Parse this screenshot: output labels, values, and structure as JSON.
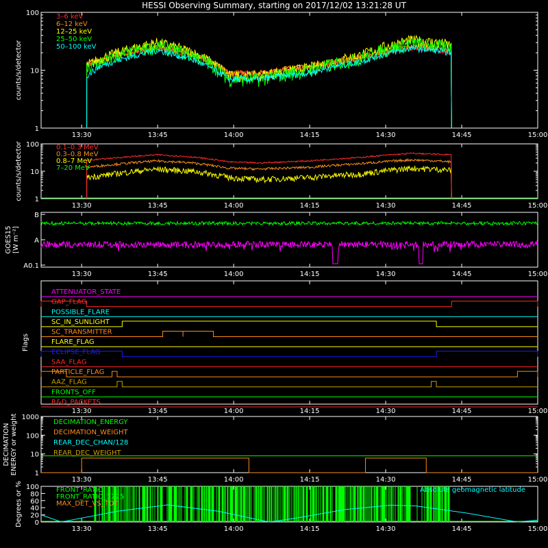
{
  "title": "HESSI Observing Summary, starting on 2017/12/02 13:21:28 UT",
  "time_ticks": [
    "13:30",
    "13:45",
    "14:00",
    "14:15",
    "14:30",
    "14:45",
    "15:00"
  ],
  "colors": {
    "background": "#000000",
    "axes": "#ffffff",
    "red": "#ff2a2a",
    "orange": "#ff8c1a",
    "yellow": "#ffff00",
    "green": "#00ff00",
    "cyan": "#00ffff",
    "magenta": "#ff00ff",
    "blue": "#1a1aff",
    "olive": "#c8a000",
    "mint": "#00ff88"
  },
  "chart_data": [
    {
      "id": "lo",
      "type": "line",
      "ylabel": "counts/s/detector",
      "yscale": "log",
      "ylim": [
        1,
        100
      ],
      "yticks": [
        "1",
        "10",
        "100"
      ],
      "x": [
        "13:31",
        "13:34",
        "13:45",
        "13:52",
        "13:59",
        "14:05",
        "14:15",
        "14:25",
        "14:35",
        "14:40",
        "14:43"
      ],
      "series": [
        {
          "name": "3–6 keV",
          "color": "#ff2a2a",
          "values": [
            13,
            15,
            24,
            18,
            9,
            9,
            11,
            16,
            24,
            22,
            20
          ]
        },
        {
          "name": "6–12 keV",
          "color": "#ff8c1a",
          "values": [
            12,
            15,
            25,
            19,
            9,
            9,
            12,
            17,
            26,
            24,
            22
          ]
        },
        {
          "name": "12–25 keV",
          "color": "#ffff00",
          "values": [
            12,
            16,
            30,
            20,
            8,
            8,
            11,
            18,
            33,
            30,
            27
          ]
        },
        {
          "name": "25–50 keV",
          "color": "#00ff00",
          "values": [
            10,
            14,
            26,
            18,
            7,
            7,
            10,
            16,
            29,
            27,
            24
          ]
        },
        {
          "name": "50–100 keV",
          "color": "#00ffff",
          "values": [
            8,
            12,
            22,
            15,
            7,
            7,
            9,
            14,
            24,
            22,
            20
          ]
        }
      ]
    },
    {
      "id": "hi",
      "type": "line",
      "ylabel": "counts/s/detector",
      "yscale": "log",
      "ylim": [
        1,
        100
      ],
      "yticks": [
        "1",
        "10",
        "100"
      ],
      "x": [
        "13:31",
        "13:34",
        "13:45",
        "13:52",
        "13:59",
        "14:05",
        "14:15",
        "14:25",
        "14:35",
        "14:40",
        "14:43"
      ],
      "series": [
        {
          "name": "0.1–0.3 MeV",
          "color": "#ff2a2a",
          "values": [
            25,
            28,
            40,
            33,
            22,
            20,
            24,
            32,
            45,
            42,
            40
          ]
        },
        {
          "name": "0.3–0.8 MeV",
          "color": "#ff8c1a",
          "values": [
            14,
            16,
            24,
            20,
            13,
            12,
            14,
            19,
            26,
            24,
            22
          ]
        },
        {
          "name": "0.8–7 MeV",
          "color": "#ffff00",
          "values": [
            6,
            7,
            12,
            10,
            6,
            5,
            6,
            8,
            13,
            12,
            11
          ]
        },
        {
          "name": "7–20 MeV",
          "color": "#00ff00",
          "values": []
        }
      ]
    },
    {
      "id": "goes",
      "type": "line",
      "ylabel": "GOES15",
      "ylabel2": "[W m⁻²]",
      "yticks": [
        "A0.1",
        "A",
        "B"
      ],
      "x": [
        "13:22",
        "13:45",
        "14:00",
        "14:18",
        "14:20",
        "14:30",
        "14:37",
        "14:45",
        "15:00"
      ],
      "series": [
        {
          "name": "GOES long",
          "color": "#00ff00",
          "values": [
            "B",
            "B",
            "B",
            "B",
            "B",
            "B",
            "B",
            "B",
            "B"
          ]
        },
        {
          "name": "GOES short",
          "color": "#ff00ff",
          "values": [
            "A",
            "A",
            "A",
            "A",
            "A0.1",
            "A",
            "A0.1",
            "A",
            "A"
          ]
        }
      ]
    },
    {
      "id": "flags",
      "type": "table",
      "ylabel": "Flags",
      "rows": [
        {
          "name": "ATTENUATOR_STATE",
          "color": "#ff00ff",
          "segments": []
        },
        {
          "name": "GAP_FLAG",
          "color": "#ff2a2a",
          "segments": [
            [
              "13:22",
              "13:31"
            ],
            [
              "14:43",
              "15:00"
            ]
          ]
        },
        {
          "name": "POSSIBLE_FLARE",
          "color": "#00ffff",
          "segments": []
        },
        {
          "name": "SC_IN_SUNLIGHT",
          "color": "#ffff00",
          "segments": [
            [
              "13:38",
              "14:40"
            ]
          ]
        },
        {
          "name": "SC_TRANSMITTER",
          "color": "#ff8c1a",
          "segments": [
            [
              "13:46",
              "13:50"
            ],
            [
              "13:50",
              "13:56"
            ]
          ]
        },
        {
          "name": "FLARE_FLAG",
          "color": "#ffff00",
          "segments": []
        },
        {
          "name": "ECLIPSE_FLAG",
          "color": "#1a1aff",
          "segments": [
            [
              "13:22",
              "13:38"
            ],
            [
              "14:40",
              "15:00"
            ]
          ]
        },
        {
          "name": "SAA_FLAG",
          "color": "#ff2a2a",
          "segments": []
        },
        {
          "name": "PARTICLE_FLAG",
          "color": "#ff8c1a",
          "segments": [
            [
              "13:22",
              "13:27"
            ],
            [
              "13:36",
              "13:37"
            ],
            [
              "14:56",
              "15:00"
            ]
          ]
        },
        {
          "name": "AAZ_FLAG",
          "color": "#c8a000",
          "segments": [
            [
              "13:37",
              "13:38"
            ],
            [
              "14:39",
              "14:40"
            ]
          ]
        },
        {
          "name": "FRONTS_OFF",
          "color": "#00ff00",
          "segments": []
        },
        {
          "name": "R&D_PACKETS",
          "color": "#ff2a2a",
          "segments": []
        }
      ]
    },
    {
      "id": "decim",
      "type": "line",
      "ylabel": "DECIMATION",
      "ylabel2": "ENERGY or weight",
      "yscale": "log",
      "ylim": [
        1,
        1000
      ],
      "yticks": [
        "1",
        "10",
        "100",
        "1000"
      ],
      "series": [
        {
          "name": "DECIMATION_ENERGY",
          "color": "#00ff00",
          "steps": [
            [
              "13:22",
              8
            ],
            [
              "13:30",
              8
            ],
            [
              "14:03",
              8
            ],
            [
              "14:26",
              8
            ],
            [
              "14:38",
              8
            ],
            [
              "15:00",
              8
            ]
          ]
        },
        {
          "name": "DECIMATION_WEIGHT",
          "color": "#ff8c1a",
          "steps": [
            [
              "13:22",
              1
            ],
            [
              "13:30",
              6
            ],
            [
              "14:03",
              1
            ],
            [
              "14:26",
              6
            ],
            [
              "14:38",
              1
            ],
            [
              "15:00",
              1
            ]
          ]
        },
        {
          "name": "REAR_DEC_CHAN/128",
          "color": "#00ffff",
          "steps": []
        },
        {
          "name": "REAR_DEC_WEIGHT",
          "color": "#c8a000",
          "steps": []
        }
      ]
    },
    {
      "id": "ratio",
      "type": "line",
      "ylabel": "Degrees or %",
      "ylim": [
        0,
        100
      ],
      "yticks": [
        "0",
        "20",
        "40",
        "60",
        "80",
        "100"
      ],
      "legend_right": "Absolute geomagnetic latitude",
      "series": [
        {
          "name": "FRONT_RATIO",
          "color": "#00ff00",
          "values": []
        },
        {
          "name": "FRONT_RATIO_1225",
          "color": "#00ff00",
          "values": []
        },
        {
          "name": "MAX_DET_VS_TOT",
          "color": "#ff8c1a",
          "values": []
        },
        {
          "name": "Absolute geomagnetic latitude",
          "color": "#00ffff",
          "x": [
            "13:22",
            "13:26",
            "13:37",
            "13:47",
            "13:57",
            "14:07",
            "14:12",
            "14:22",
            "14:31",
            "14:36",
            "14:46",
            "14:56",
            "15:00"
          ],
          "values": [
            20,
            0,
            30,
            48,
            30,
            0,
            10,
            35,
            47,
            45,
            25,
            0,
            5
          ]
        }
      ]
    }
  ]
}
